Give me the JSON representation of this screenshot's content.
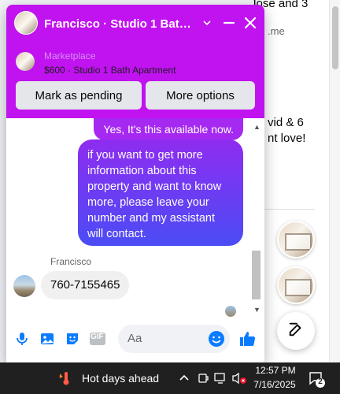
{
  "background": {
    "snippet_top": "Jose and 3",
    "snippet_link": ".me",
    "snippet_mid1": "vid & 6",
    "snippet_mid2": "nt love!"
  },
  "chat": {
    "title": "Francisco · Studio 1 Bath A...",
    "listing": {
      "label": "Marketplace",
      "price_title": "$600 · Studio 1 Bath Apartment"
    },
    "buttons": {
      "mark_pending": "Mark as pending",
      "more_options": "More options"
    },
    "messages": {
      "outgoing_short": "Yes, It's this available now.",
      "outgoing_long": "if you want to get more information about this property and want to know more, please leave your number and my assistant will contact.",
      "sender_name": "Francisco",
      "incoming": "760-7155465"
    },
    "composer": {
      "placeholder": "Aa",
      "gif_label": "GIF"
    }
  },
  "taskbar": {
    "weather": "Hot days ahead",
    "time": "12:57 PM",
    "date": "7/16/2025",
    "notification_count": "2"
  },
  "colors": {
    "header": "#c112f0",
    "accent_blue": "#0a7cff",
    "bubble_gradient_top": "#8f2cf0",
    "bubble_gradient_bottom": "#4b4cf5"
  }
}
